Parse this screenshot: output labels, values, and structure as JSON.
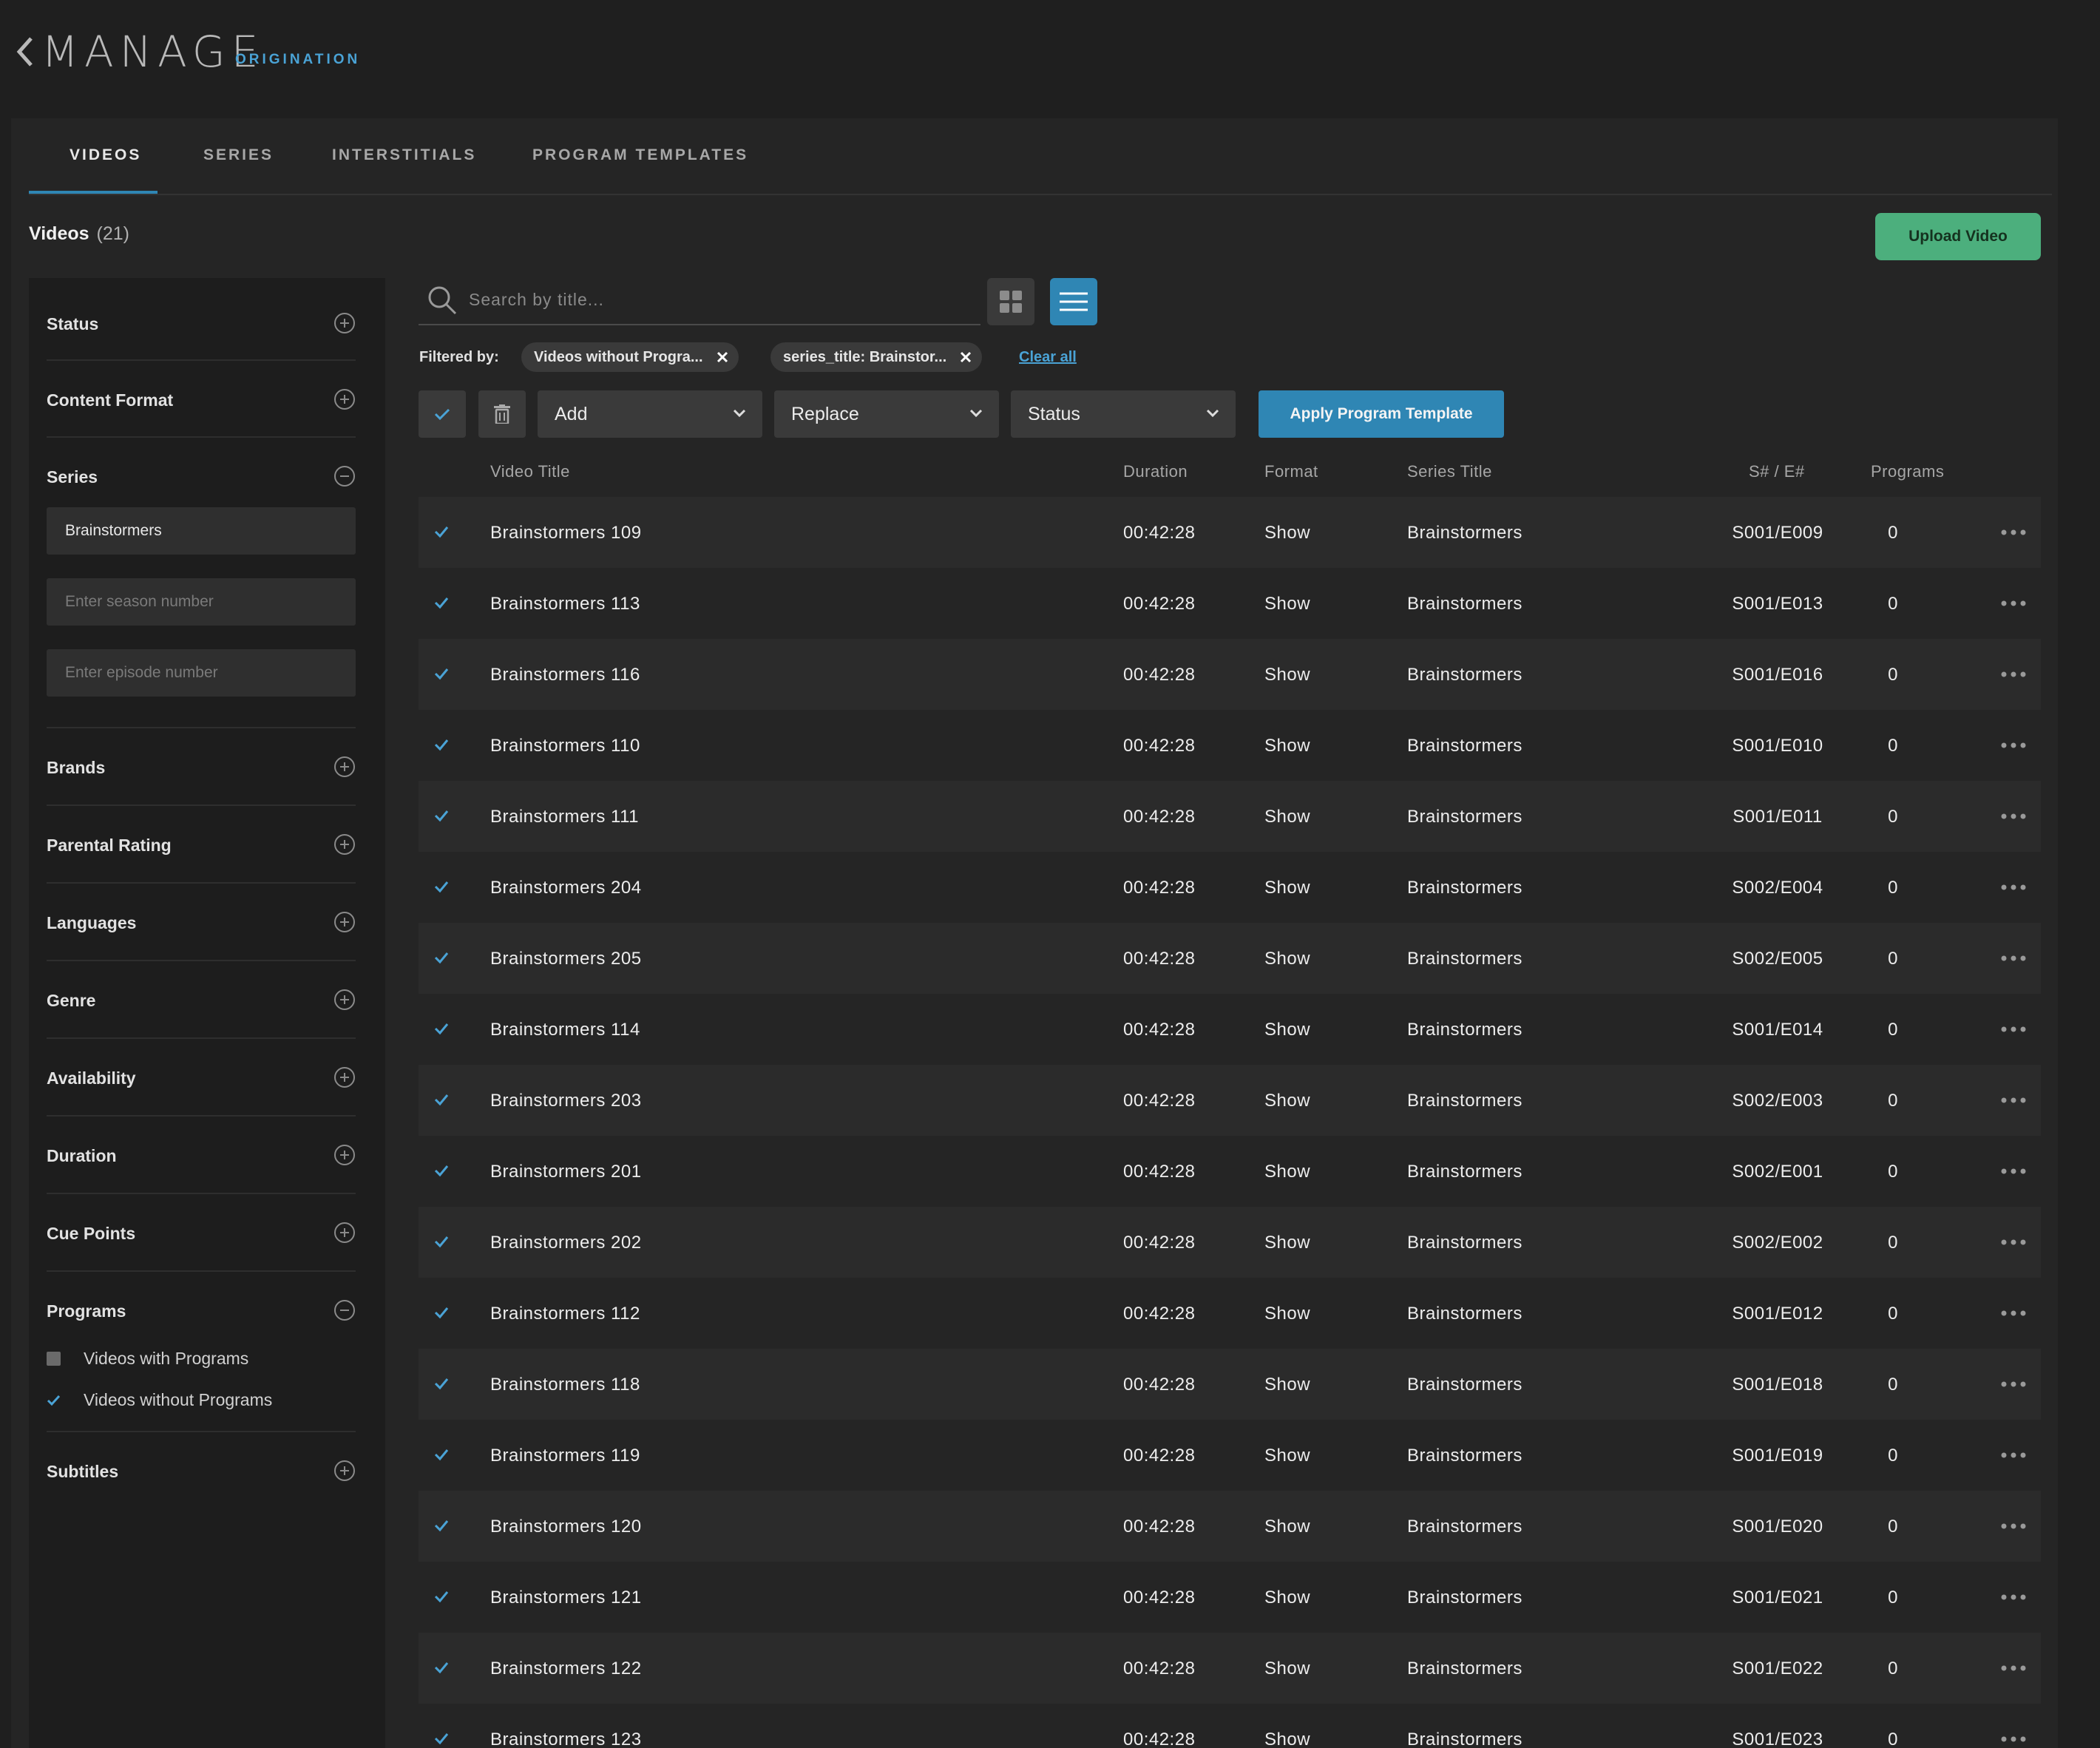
{
  "header": {
    "title": "MANAGE",
    "subtitle": "ORIGINATION"
  },
  "tabs": [
    "VIDEOS",
    "SERIES",
    "INTERSTITIALS",
    "PROGRAM TEMPLATES"
  ],
  "heading": {
    "label": "Videos",
    "count": "(21)"
  },
  "upload_label": "Upload Video",
  "sidebar": {
    "status": "Status",
    "content_format": "Content Format",
    "series": "Series",
    "series_value": "Brainstormers",
    "season_placeholder": "Enter season number",
    "episode_placeholder": "Enter episode number",
    "brands": "Brands",
    "parental_rating": "Parental Rating",
    "languages": "Languages",
    "genre": "Genre",
    "availability": "Availability",
    "duration": "Duration",
    "cue_points": "Cue Points",
    "programs": "Programs",
    "with_programs": "Videos with Programs",
    "with_programs_checked": false,
    "without_programs": "Videos without Programs",
    "without_programs_checked": true,
    "subtitles": "Subtitles"
  },
  "search_placeholder": "Search by title...",
  "filtered_by": "Filtered by:",
  "chips": [
    "Videos without Progra...",
    "series_title: Brainstor..."
  ],
  "clear_all": "Clear all",
  "bulk": {
    "add": "Add",
    "replace": "Replace",
    "status": "Status",
    "apply": "Apply Program Template"
  },
  "columns": [
    "Video Title",
    "Duration",
    "Format",
    "Series Title",
    "S# / E#",
    "Programs"
  ],
  "rows": [
    {
      "title": "Brainstormers 109",
      "duration": "00:42:28",
      "format": "Show",
      "series": "Brainstormers",
      "se": "S001/E009",
      "programs": "0"
    },
    {
      "title": "Brainstormers 113",
      "duration": "00:42:28",
      "format": "Show",
      "series": "Brainstormers",
      "se": "S001/E013",
      "programs": "0"
    },
    {
      "title": "Brainstormers 116",
      "duration": "00:42:28",
      "format": "Show",
      "series": "Brainstormers",
      "se": "S001/E016",
      "programs": "0"
    },
    {
      "title": "Brainstormers 110",
      "duration": "00:42:28",
      "format": "Show",
      "series": "Brainstormers",
      "se": "S001/E010",
      "programs": "0"
    },
    {
      "title": "Brainstormers 111",
      "duration": "00:42:28",
      "format": "Show",
      "series": "Brainstormers",
      "se": "S001/E011",
      "programs": "0"
    },
    {
      "title": "Brainstormers 204",
      "duration": "00:42:28",
      "format": "Show",
      "series": "Brainstormers",
      "se": "S002/E004",
      "programs": "0"
    },
    {
      "title": "Brainstormers 205",
      "duration": "00:42:28",
      "format": "Show",
      "series": "Brainstormers",
      "se": "S002/E005",
      "programs": "0"
    },
    {
      "title": "Brainstormers 114",
      "duration": "00:42:28",
      "format": "Show",
      "series": "Brainstormers",
      "se": "S001/E014",
      "programs": "0"
    },
    {
      "title": "Brainstormers 203",
      "duration": "00:42:28",
      "format": "Show",
      "series": "Brainstormers",
      "se": "S002/E003",
      "programs": "0"
    },
    {
      "title": "Brainstormers 201",
      "duration": "00:42:28",
      "format": "Show",
      "series": "Brainstormers",
      "se": "S002/E001",
      "programs": "0"
    },
    {
      "title": "Brainstormers 202",
      "duration": "00:42:28",
      "format": "Show",
      "series": "Brainstormers",
      "se": "S002/E002",
      "programs": "0"
    },
    {
      "title": "Brainstormers 112",
      "duration": "00:42:28",
      "format": "Show",
      "series": "Brainstormers",
      "se": "S001/E012",
      "programs": "0"
    },
    {
      "title": "Brainstormers 118",
      "duration": "00:42:28",
      "format": "Show",
      "series": "Brainstormers",
      "se": "S001/E018",
      "programs": "0"
    },
    {
      "title": "Brainstormers 119",
      "duration": "00:42:28",
      "format": "Show",
      "series": "Brainstormers",
      "se": "S001/E019",
      "programs": "0"
    },
    {
      "title": "Brainstormers 120",
      "duration": "00:42:28",
      "format": "Show",
      "series": "Brainstormers",
      "se": "S001/E020",
      "programs": "0"
    },
    {
      "title": "Brainstormers 121",
      "duration": "00:42:28",
      "format": "Show",
      "series": "Brainstormers",
      "se": "S001/E021",
      "programs": "0"
    },
    {
      "title": "Brainstormers 122",
      "duration": "00:42:28",
      "format": "Show",
      "series": "Brainstormers",
      "se": "S001/E022",
      "programs": "0"
    },
    {
      "title": "Brainstormers 123",
      "duration": "00:42:28",
      "format": "Show",
      "series": "Brainstormers",
      "se": "S001/E023",
      "programs": "0"
    }
  ],
  "colors": {
    "accent_blue": "#2f86b4",
    "upload_green": "#4caf7d",
    "link_blue": "#4aa3d6"
  }
}
